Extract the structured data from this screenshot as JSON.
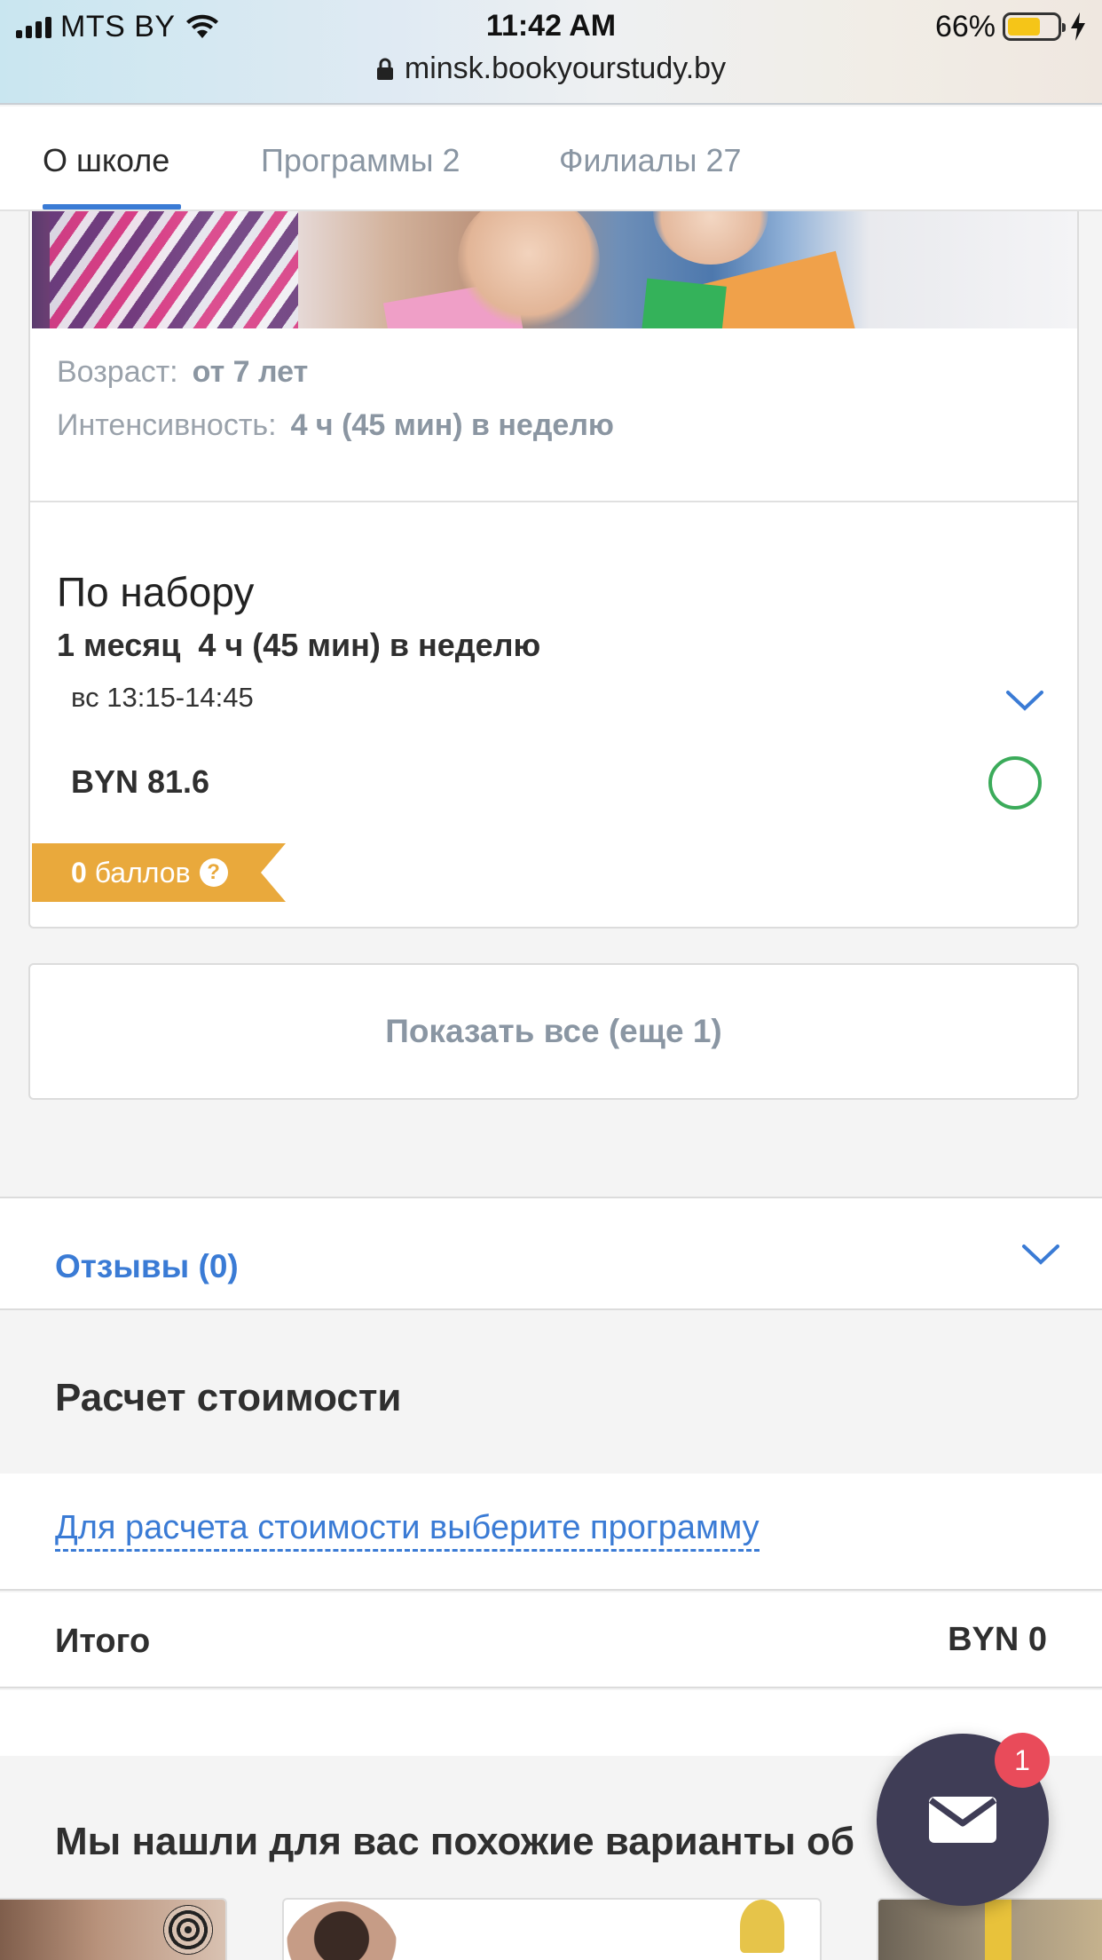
{
  "status_bar": {
    "carrier": "MTS BY",
    "time": "11:42 AM",
    "battery_percent": "66%",
    "battery_level": 0.66,
    "url": "minsk.bookyourstudy.by"
  },
  "tabs": [
    {
      "label": "О школе",
      "active": true
    },
    {
      "label": "Программы 2",
      "active": false
    },
    {
      "label": "Филиалы 27",
      "active": false
    }
  ],
  "program": {
    "age_label": "Возраст:",
    "age_value": "от 7 лет",
    "intensity_label": "Интенсивность:",
    "intensity_value": "4 ч (45 мин) в неделю",
    "offer": {
      "title": "По набору",
      "duration": "1 месяц",
      "intensity": "4 ч (45 мин) в неделю",
      "schedule": "вс 13:15-14:45",
      "price": "BYN 81.6",
      "points_value": "0",
      "points_unit": "баллов",
      "points_help_icon": "?"
    }
  },
  "show_all_label": "Показать все (еще 1)",
  "reviews_label": "Отзывы (0)",
  "cost_calc": {
    "title": "Расчет стоимости",
    "select_prompt": "Для расчета стоимости выберите программу",
    "total_label": "Итого",
    "total_value": "BYN 0"
  },
  "similar": {
    "title": "Мы нашли для вас похожие варианты об"
  },
  "chat": {
    "icon": "mail-icon",
    "badge_count": "1"
  },
  "colors": {
    "accent_blue": "#3a7bd5",
    "points_orange": "#e9a93c",
    "radio_green": "#3bab5a",
    "chat_bg": "#3f3d56",
    "badge_red": "#e94b5a"
  }
}
